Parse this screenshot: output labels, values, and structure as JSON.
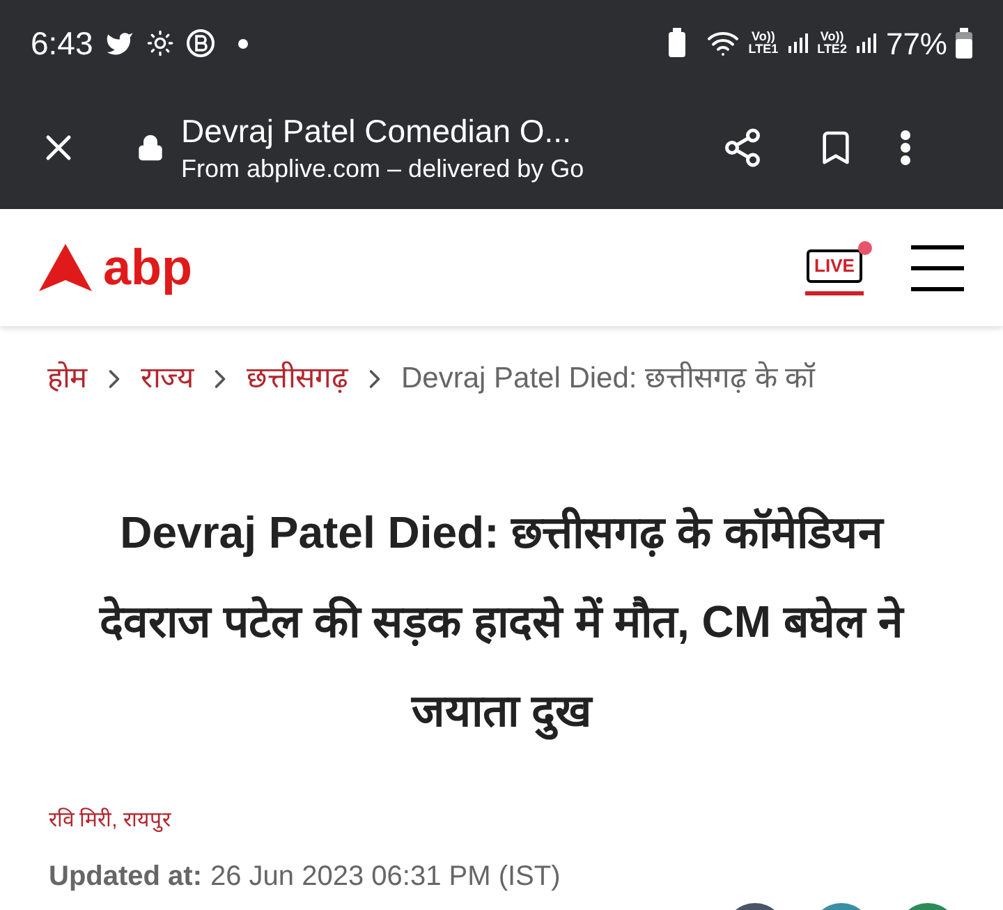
{
  "status_bar": {
    "time": "6:43",
    "network_1": "LTE1",
    "network_2": "LTE2",
    "volte_1": "Vo))",
    "volte_2": "Vo))",
    "battery": "77%"
  },
  "browser_bar": {
    "title": "Devraj Patel Comedian O...",
    "subtitle": "From abplive.com – delivered by Go"
  },
  "header": {
    "logo": "abp",
    "live": "LIVE"
  },
  "breadcrumb": [
    {
      "label": "होम",
      "kind": "link"
    },
    {
      "label": "राज्य",
      "kind": "link"
    },
    {
      "label": "छत्तीसगढ़",
      "kind": "link"
    },
    {
      "label": "Devraj Patel Died: छत्तीसगढ़ के कॉ",
      "kind": "current"
    }
  ],
  "headline": "Devraj Patel Died: छत्तीसगढ़ के कॉमेडियन देवराज पटेल की सड़क हादसे में मौत, CM बघेल ने जयाता दुख",
  "byline": "रवि मिरी, रायपुर",
  "updated": {
    "label": "Updated at:",
    "value": "26 Jun 2023 06:31 PM (IST)"
  }
}
